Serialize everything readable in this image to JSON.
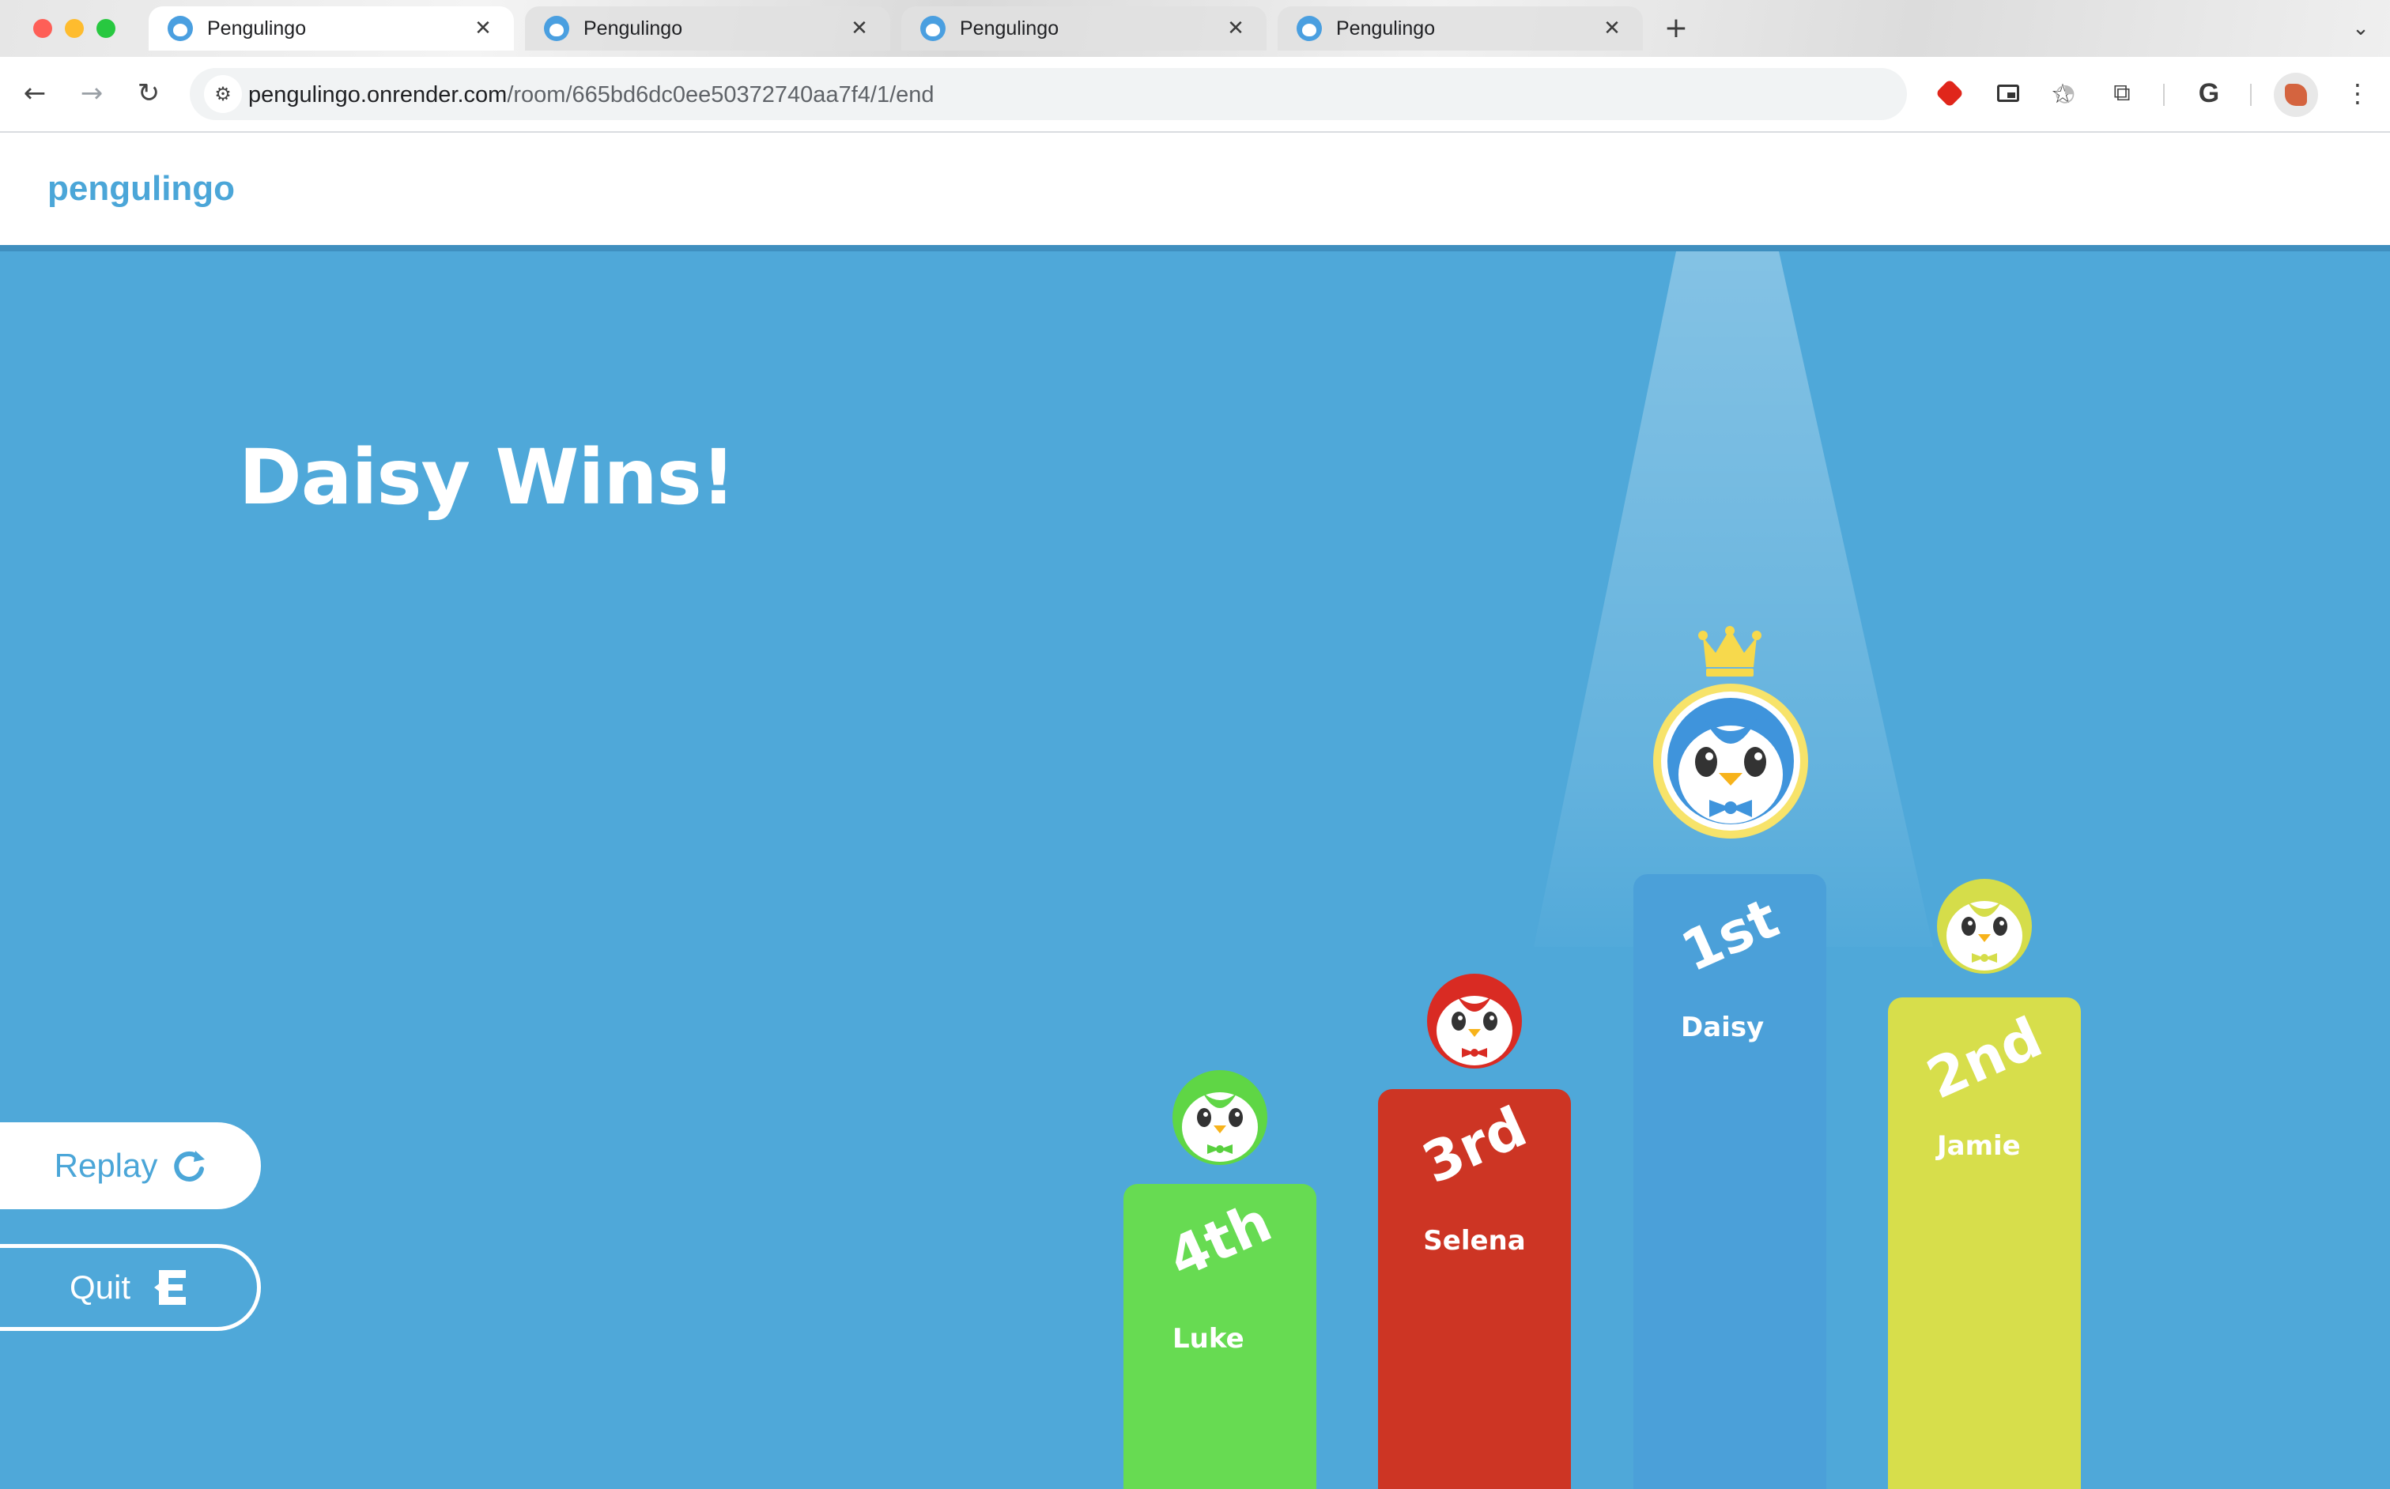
{
  "browser": {
    "tabs": [
      {
        "title": "Pengulingo",
        "active": true
      },
      {
        "title": "Pengulingo",
        "active": false
      },
      {
        "title": "Pengulingo",
        "active": false
      },
      {
        "title": "Pengulingo",
        "active": false
      }
    ],
    "tab_close_glyph": "✕",
    "new_tab_glyph": "+",
    "url_host": "pengulingo.onrender.com",
    "url_path": "/room/665bd6dc0ee50372740aa7f4/1/end",
    "icons": [
      "back-icon",
      "forward-icon",
      "reload-icon",
      "site-info-icon",
      "bookmark-star-icon",
      "adblock-icon",
      "picture-in-picture-icon",
      "timer-icon",
      "extensions-puzzle-icon",
      "google-icon",
      "profile-avatar",
      "menu-kebab-icon"
    ]
  },
  "app": {
    "logo": "pengulingo",
    "brand_color": "#4ba6d8"
  },
  "end_screen": {
    "title": "Daisy Wins!",
    "replay_label": "Replay",
    "quit_label": "Quit",
    "stage_color": "#4fa8d9"
  },
  "podium": [
    {
      "place": "4th",
      "name": "Luke",
      "color": "#67db52",
      "penguin_color": "#5fd645",
      "bow_color": "#58d03e"
    },
    {
      "place": "3rd",
      "name": "Selena",
      "color": "#cd3524",
      "penguin_color": "#d92b23",
      "bow_color": "#d92b23"
    },
    {
      "place": "1st",
      "name": "Daisy",
      "color": "#4ba0d9",
      "penguin_color": "#3f94dc",
      "bow_color": "#3f94dc",
      "crown": true
    },
    {
      "place": "2nd",
      "name": "Jamie",
      "color": "#d7de4b",
      "penguin_color": "#d5dd4a",
      "bow_color": "#d5dd4a"
    }
  ]
}
